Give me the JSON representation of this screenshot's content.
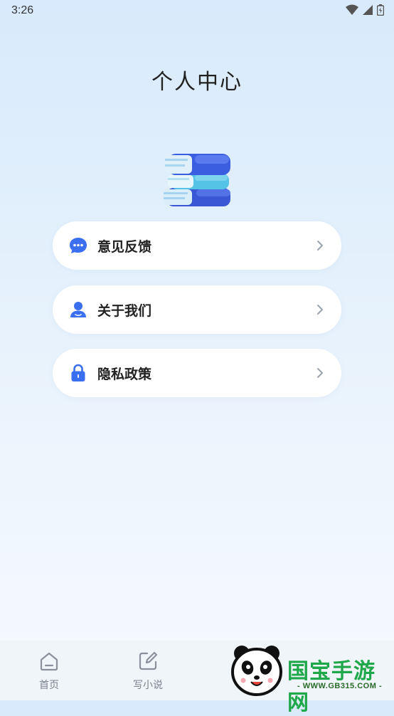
{
  "status_bar": {
    "time": "3:26"
  },
  "page": {
    "title": "个人中心"
  },
  "menu": [
    {
      "label": "意见反馈",
      "icon": "chat-bubble-icon"
    },
    {
      "label": "关于我们",
      "icon": "user-icon"
    },
    {
      "label": "隐私政策",
      "icon": "lock-icon"
    }
  ],
  "tabs": [
    {
      "label": "首页",
      "icon": "home-icon"
    },
    {
      "label": "写小说",
      "icon": "edit-icon"
    }
  ],
  "watermark": {
    "brand": "国宝手游网",
    "url": "- WWW.GB315.COM -"
  },
  "colors": {
    "accent": "#3a6ff0",
    "card": "#ffffff",
    "chevron": "#9aa3ad"
  }
}
